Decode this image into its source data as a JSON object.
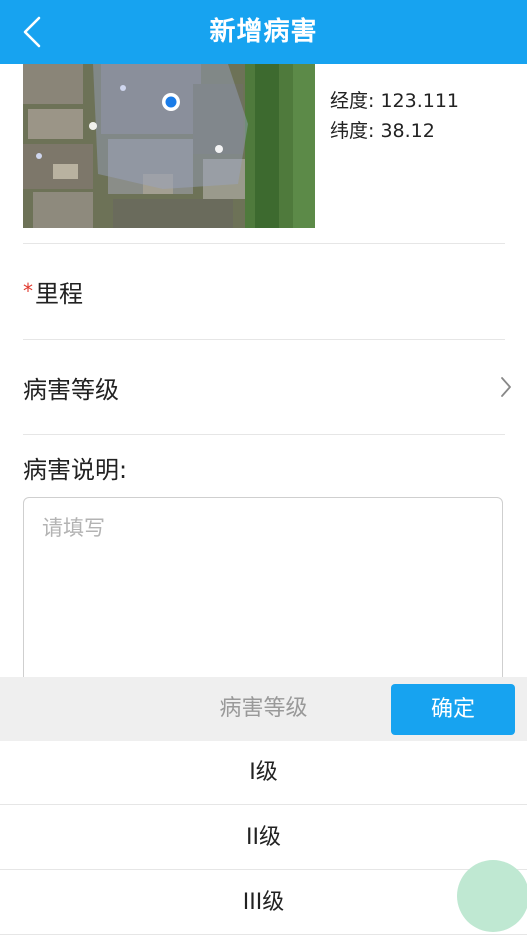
{
  "header": {
    "title": "新增病害",
    "back_icon": "chevron-left-icon"
  },
  "location": {
    "longitude_label": "经度:",
    "longitude_value": "123.111",
    "latitude_label": "纬度:",
    "latitude_value": "38.12"
  },
  "form": {
    "mileage": {
      "required_mark": "*",
      "label": "里程"
    },
    "damage_level": {
      "label": "病害等级",
      "chevron_icon": "chevron-right-icon"
    },
    "description": {
      "label": "病害说明:",
      "placeholder": "请填写",
      "value": ""
    }
  },
  "picker": {
    "title": "病害等级",
    "confirm_label": "确定",
    "options": [
      "I级",
      "II级",
      "III级"
    ]
  },
  "colors": {
    "brand": "#17a3f0",
    "required": "#e03a2f",
    "float_button": "#bfe8d2"
  }
}
